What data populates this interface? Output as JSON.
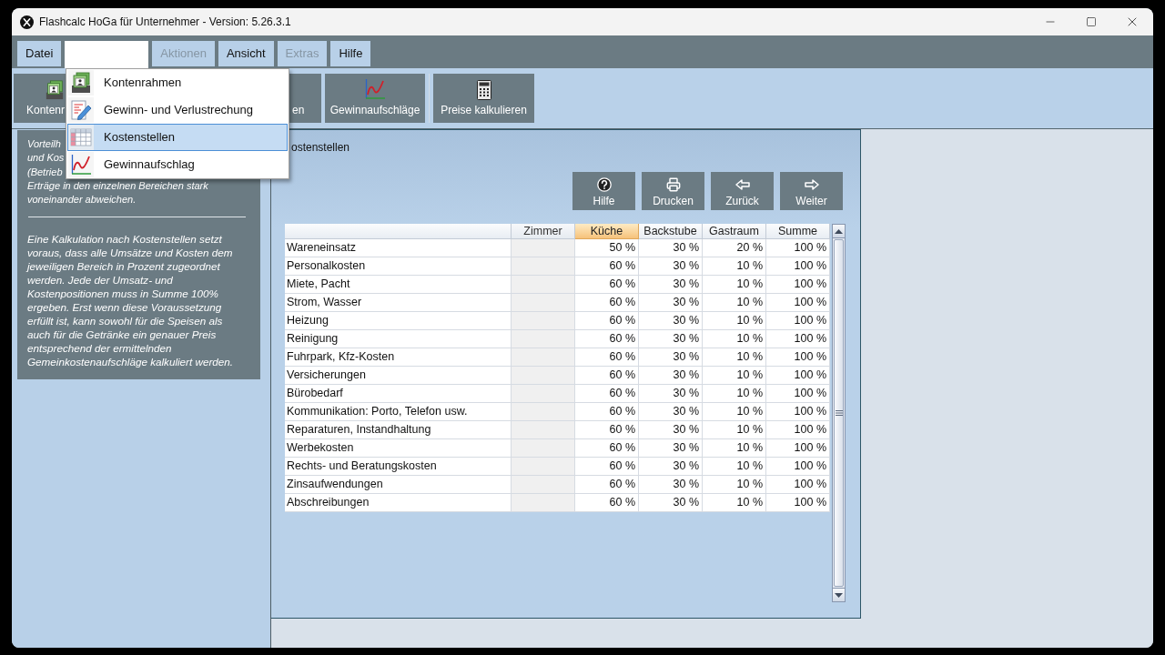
{
  "window": {
    "title": "Flashcalc HoGa für Unternehmer - Version: 5.26.3.1"
  },
  "menu": [
    {
      "label": "Datei",
      "disabled": false,
      "expanded": false
    },
    {
      "disabled": false,
      "expanded": true
    },
    {
      "label": "Aktionen",
      "disabled": true,
      "expanded": false
    },
    {
      "label": "Ansicht",
      "disabled": false,
      "expanded": false
    },
    {
      "label": "Extras",
      "disabled": true,
      "expanded": false
    },
    {
      "label": "Hilfe",
      "disabled": false,
      "expanded": false
    }
  ],
  "dropdown": {
    "items": [
      {
        "label": "Kontenrahmen",
        "selected": false
      },
      {
        "label": "Gewinn- und Verlustrechung",
        "selected": false
      },
      {
        "label": "Kostenstellen",
        "selected": true
      },
      {
        "label": "Gewinnaufschlag",
        "selected": false
      }
    ]
  },
  "toolbar": {
    "buttons": [
      {
        "label": "Kontenr"
      },
      {
        "label": "en"
      },
      {
        "label": "Gewinnaufschläge"
      },
      {
        "label": "Preise kalkulieren"
      }
    ]
  },
  "info_panel": {
    "intro_lines": [
      "Vorteilh",
      "und Kos",
      "(Betrieb",
      "Erträge in den einzelnen Bereichen stark",
      "voneinander abweichen."
    ],
    "paragraph": "Eine Kalkulation nach Kostenstellen setzt voraus, dass alle Umsätze und Kosten dem jeweiligen Bereich in Prozent zugeordnet werden. Jede der Umsatz- und Kostenpositionen muss in Summe 100% ergeben. Erst wenn diese Voraussetzung erfüllt ist, kann sowohl für die Speisen als auch für die Getränke ein genauer Preis entsprechend der ermittelnden Gemeinkostenaufschläge kalkuliert werden."
  },
  "content": {
    "title": "ostenstellen",
    "buttons": [
      {
        "label": "Hilfe"
      },
      {
        "label": "Drucken"
      },
      {
        "label": "Zurück"
      },
      {
        "label": "Weiter"
      }
    ],
    "table": {
      "columns": [
        {
          "label": "Zimmer",
          "selected": false,
          "disabled": true
        },
        {
          "label": "Küche",
          "selected": true,
          "disabled": false
        },
        {
          "label": "Backstube",
          "selected": false,
          "disabled": false
        },
        {
          "label": "Gastraum",
          "selected": false,
          "disabled": false
        },
        {
          "label": "Summe",
          "selected": false,
          "disabled": false
        }
      ],
      "rows": [
        {
          "label": "Wareneinsatz",
          "cells": [
            null,
            "50 %",
            "30 %",
            "20 %",
            "100 %"
          ]
        },
        {
          "label": "Personalkosten",
          "cells": [
            null,
            "60 %",
            "30 %",
            "10 %",
            "100 %"
          ]
        },
        {
          "label": "Miete, Pacht",
          "cells": [
            null,
            "60 %",
            "30 %",
            "10 %",
            "100 %"
          ]
        },
        {
          "label": "Strom, Wasser",
          "cells": [
            null,
            "60 %",
            "30 %",
            "10 %",
            "100 %"
          ]
        },
        {
          "label": "Heizung",
          "cells": [
            null,
            "60 %",
            "30 %",
            "10 %",
            "100 %"
          ]
        },
        {
          "label": "Reinigung",
          "cells": [
            null,
            "60 %",
            "30 %",
            "10 %",
            "100 %"
          ]
        },
        {
          "label": "Fuhrpark, Kfz-Kosten",
          "cells": [
            null,
            "60 %",
            "30 %",
            "10 %",
            "100 %"
          ]
        },
        {
          "label": "Versicherungen",
          "cells": [
            null,
            "60 %",
            "30 %",
            "10 %",
            "100 %"
          ]
        },
        {
          "label": "Bürobedarf",
          "cells": [
            null,
            "60 %",
            "30 %",
            "10 %",
            "100 %"
          ]
        },
        {
          "label": "Kommunikation: Porto, Telefon usw.",
          "cells": [
            null,
            "60 %",
            "30 %",
            "10 %",
            "100 %"
          ]
        },
        {
          "label": "Reparaturen, Instandhaltung",
          "cells": [
            null,
            "60 %",
            "30 %",
            "10 %",
            "100 %"
          ]
        },
        {
          "label": "Werbekosten",
          "cells": [
            null,
            "60 %",
            "30 %",
            "10 %",
            "100 %"
          ]
        },
        {
          "label": "Rechts- und Beratungskosten",
          "cells": [
            null,
            "60 %",
            "30 %",
            "10 %",
            "100 %"
          ]
        },
        {
          "label": "Zinsaufwendungen",
          "cells": [
            null,
            "60 %",
            "30 %",
            "10 %",
            "100 %"
          ]
        },
        {
          "label": "Abschreibungen",
          "cells": [
            null,
            "60 %",
            "30 %",
            "10 %",
            "100 %"
          ]
        }
      ]
    }
  }
}
